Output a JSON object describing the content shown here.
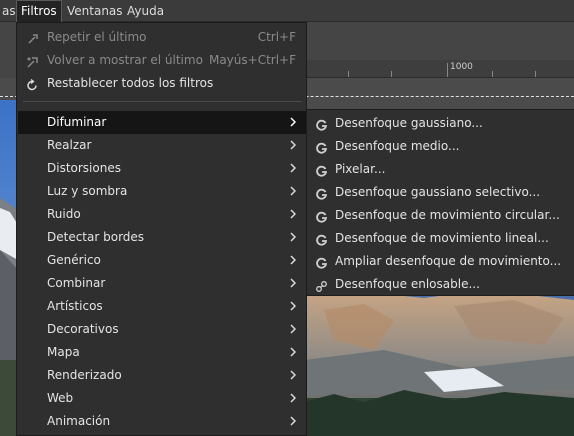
{
  "menubar": {
    "items": [
      {
        "label": "as"
      },
      {
        "label": "Filtros"
      },
      {
        "label": "Ventanas"
      },
      {
        "label": "Ayuda"
      }
    ]
  },
  "ruler": {
    "label": "1000"
  },
  "main_menu": {
    "top_items": [
      {
        "label": "Repetir el último",
        "shortcut": "Ctrl+F",
        "icon": "repeat-icon"
      },
      {
        "label": "Volver a mostrar el último",
        "shortcut": "Mayús+Ctrl+F",
        "icon": "reshow-icon"
      },
      {
        "label": "Restablecer todos los filtros",
        "shortcut": "",
        "icon": "reset-icon"
      }
    ],
    "submenus": [
      {
        "label": "Difuminar"
      },
      {
        "label": "Realzar"
      },
      {
        "label": "Distorsiones"
      },
      {
        "label": "Luz y sombra"
      },
      {
        "label": "Ruido"
      },
      {
        "label": "Detectar bordes"
      },
      {
        "label": "Genérico"
      },
      {
        "label": "Combinar"
      },
      {
        "label": "Artísticos"
      },
      {
        "label": "Decorativos"
      },
      {
        "label": "Mapa"
      },
      {
        "label": "Renderizado"
      },
      {
        "label": "Web"
      },
      {
        "label": "Animación"
      }
    ]
  },
  "blur_submenu": {
    "items": [
      {
        "label": "Desenfoque gaussiano...",
        "icon": "gegl-icon"
      },
      {
        "label": "Desenfoque medio...",
        "icon": "gegl-icon"
      },
      {
        "label": "Pixelar...",
        "icon": "gegl-icon"
      },
      {
        "label": "Desenfoque gaussiano selectivo...",
        "icon": "gegl-icon"
      },
      {
        "label": "Desenfoque de movimiento circular...",
        "icon": "gegl-icon"
      },
      {
        "label": "Desenfoque de movimiento lineal...",
        "icon": "gegl-icon"
      },
      {
        "label": "Ampliar desenfoque de movimiento...",
        "icon": "gegl-icon"
      },
      {
        "label": "Desenfoque enlosable...",
        "icon": "plugin-icon"
      }
    ]
  },
  "colors": {
    "menu_bg": "#2f2f2f",
    "selected_bg": "#151515",
    "text": "#e4e4e4",
    "disabled": "#8a8a8a"
  }
}
